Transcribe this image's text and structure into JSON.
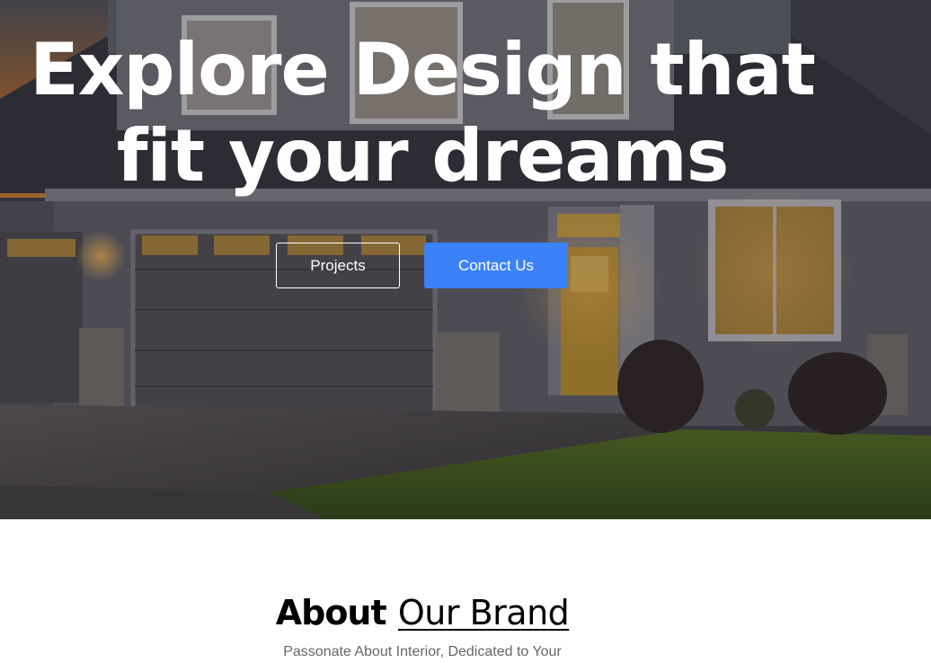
{
  "hero": {
    "title_line1": "Explore Design that",
    "title_line2": "fit your dreams",
    "buttons": {
      "projects_label": "Projects",
      "contact_label": "Contact Us"
    }
  },
  "about": {
    "title_strong": "About",
    "title_light": "Our Brand",
    "subtitle": "Passonate About Interior, Dedicated to Your"
  },
  "colors": {
    "accent": "#3b82f6",
    "hero_text": "#ffffff",
    "subtitle_text": "#666666"
  }
}
